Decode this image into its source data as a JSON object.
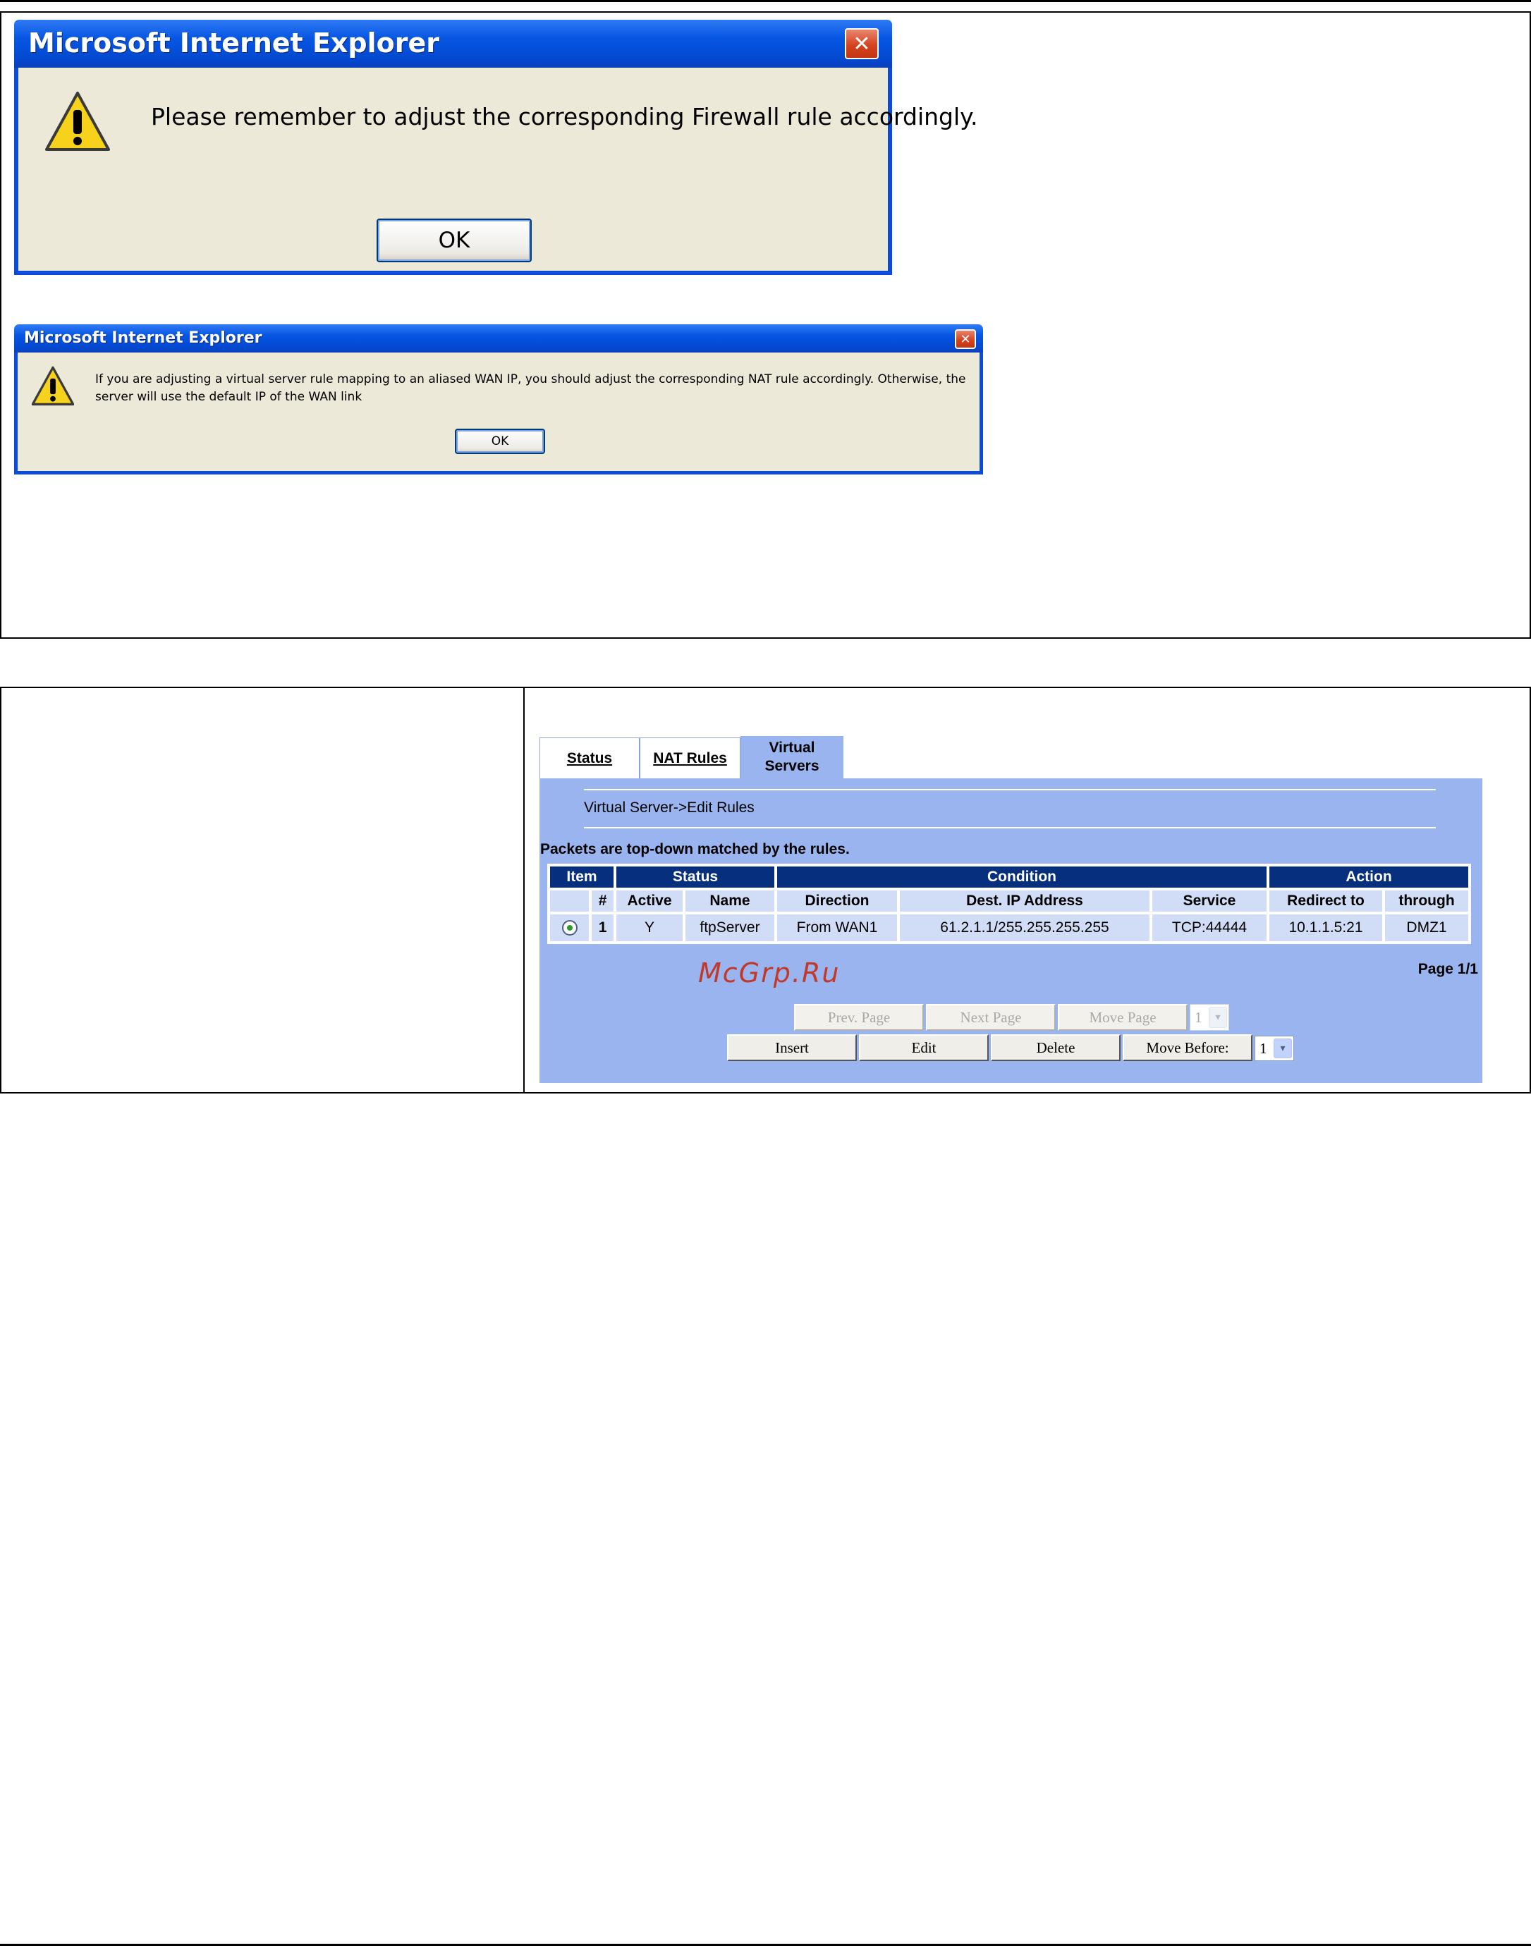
{
  "dialog1": {
    "title": "Microsoft Internet Explorer",
    "message": "Please remember to adjust the corresponding Firewall rule accordingly.",
    "ok_label": "OK"
  },
  "dialog2": {
    "title": "Microsoft Internet Explorer",
    "message": "If you are adjusting a virtual server rule mapping to an aliased WAN IP, you should adjust the corresponding NAT rule accordingly. Otherwise, the server will use the default IP of the WAN link",
    "ok_label": "OK"
  },
  "router": {
    "tabs": [
      {
        "label": "Status"
      },
      {
        "label": "NAT Rules"
      },
      {
        "label_line1": "Virtual",
        "label_line2": "Servers"
      }
    ],
    "breadcrumb": "Virtual Server->Edit Rules",
    "packets_note": "Packets are top-down matched by the rules.",
    "table": {
      "groups": [
        "Item",
        "Status",
        "Condition",
        "Action"
      ],
      "columns": [
        "#",
        "Active",
        "Name",
        "Direction",
        "Dest. IP Address",
        "Service",
        "Redirect to",
        "through"
      ],
      "rows": [
        {
          "num": "1",
          "active": "Y",
          "name": "ftpServer",
          "direction": "From WAN1",
          "dest_ip": "61.2.1.1/255.255.255.255",
          "service": "TCP:44444",
          "redirect": "10.1.1.5:21",
          "through": "DMZ1"
        }
      ]
    },
    "page_info": "Page 1/1",
    "watermark": "McGrp.Ru",
    "nav_buttons": {
      "prev": "Prev. Page",
      "next": "Next Page",
      "move_page": "Move Page",
      "move_page_value": "1"
    },
    "action_buttons": {
      "insert": "Insert",
      "edit": "Edit",
      "delete": "Delete",
      "move_before": "Move Before:",
      "move_before_value": "1"
    }
  },
  "icons": {
    "warning": "warning-icon",
    "close": "close-icon",
    "dropdown": "chevron-down-icon"
  },
  "colors": {
    "xp_title_blue": "#0655e2",
    "dialog_face": "#ece9d8",
    "router_bg": "#99b4ee",
    "header_navy": "#06307d",
    "cell_bg": "#d1ddf6"
  }
}
